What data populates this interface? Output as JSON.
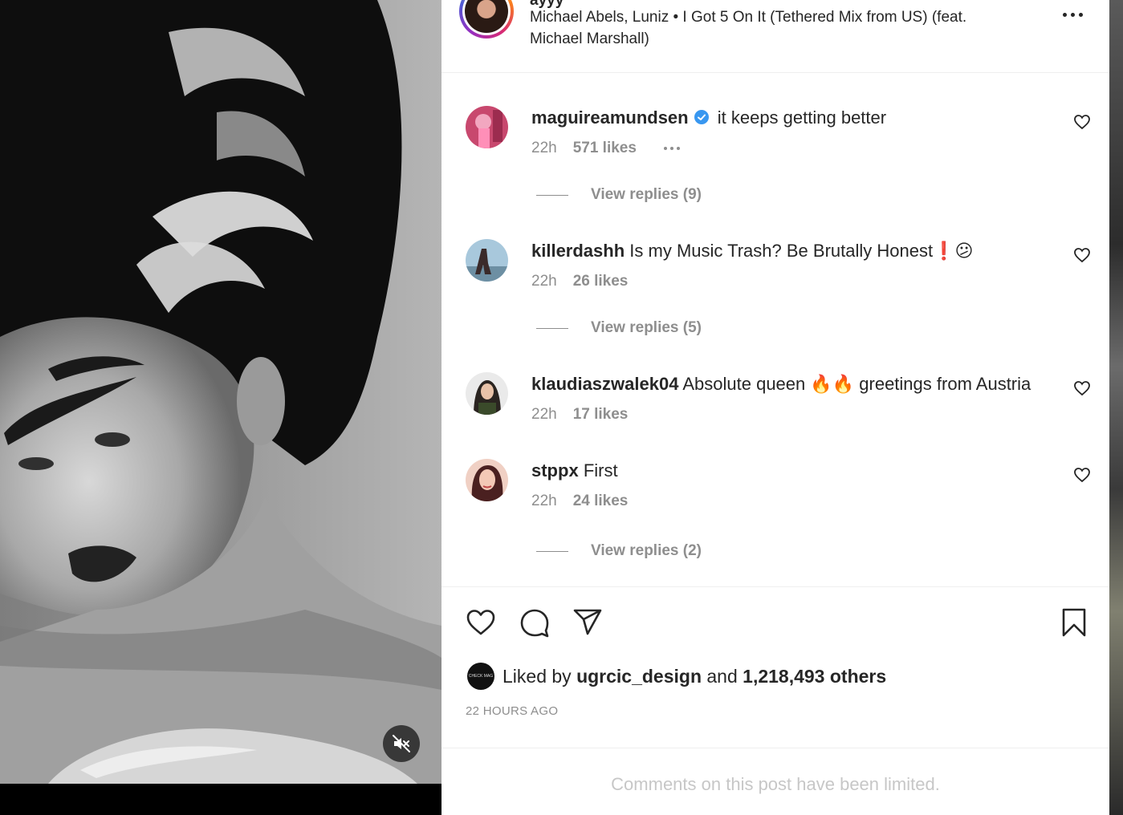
{
  "post": {
    "author_clip": "ayyy",
    "music": "Michael Abels, Luniz • I Got 5 On It (Tethered Mix from US) (feat. Michael Marshall)"
  },
  "comments": [
    {
      "user": "maguireamundsen",
      "verified": true,
      "text": "it keeps getting better",
      "time": "22h",
      "likes": "571 likes",
      "replies": "View replies (9)"
    },
    {
      "user": "killerdashh",
      "verified": false,
      "text": "Is my Music Trash? Be Brutally Honest❗😕",
      "time": "22h",
      "likes": "26 likes",
      "replies": "View replies (5)"
    },
    {
      "user": "klaudiaszwalek04",
      "verified": false,
      "text": "Absolute queen 🔥🔥 greetings from Austria",
      "time": "22h",
      "likes": "17 likes",
      "replies": ""
    },
    {
      "user": "stppx",
      "verified": false,
      "text": "First",
      "time": "22h",
      "likes": "24 likes",
      "replies": "View replies (2)"
    }
  ],
  "liked_by": {
    "prefix": "Liked by",
    "user": "ugrcic_design",
    "middle": "and",
    "count": "1,218,493 others",
    "avatar_text": "CHECK MAG"
  },
  "timestamp": "22 HOURS AGO",
  "comments_limited": "Comments on this post have been limited.",
  "icons": {
    "mute": "speaker-muted-icon",
    "like": "heart-icon",
    "comment": "comment-bubble-icon",
    "share": "paper-plane-icon",
    "save": "bookmark-icon",
    "verified": "verified-badge-icon",
    "more": "more-dots-icon"
  },
  "colors": {
    "verified": "#3897f0",
    "secondary_text": "#8e8e8e",
    "primary_text": "#262626",
    "limited_note": "#c7c7c7"
  }
}
